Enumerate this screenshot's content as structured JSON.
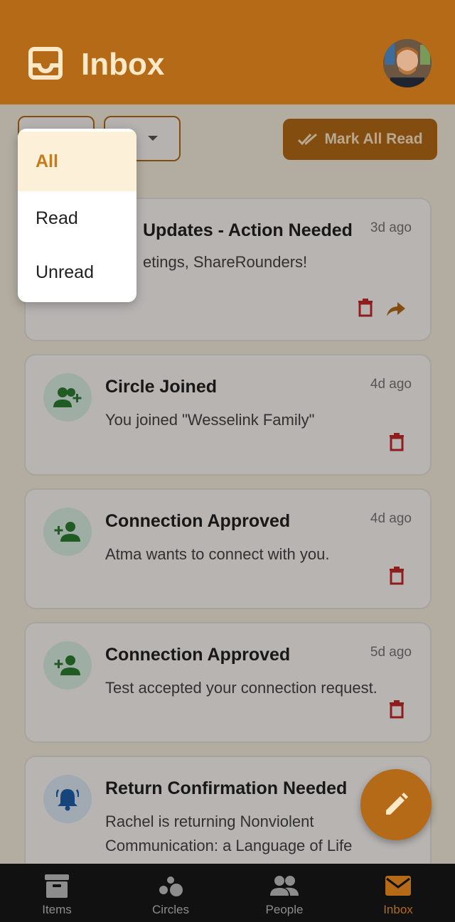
{
  "header": {
    "title": "Inbox",
    "icon": "inbox-tray-icon",
    "avatar": "user-avatar"
  },
  "toolbar": {
    "mark_all_read": "Mark All Read"
  },
  "filter_menu": {
    "options": [
      {
        "label": "All",
        "selected": true
      },
      {
        "label": "Read",
        "selected": false
      },
      {
        "label": "Unread",
        "selected": false
      }
    ]
  },
  "notifications": [
    {
      "title": "Updates - Action Needed",
      "body": "etings, ShareRounders!",
      "time": "3d ago",
      "icon": "megaphone-icon"
    },
    {
      "title": "Circle Joined",
      "body": "You joined \"Wesselink Family\"",
      "time": "4d ago",
      "icon": "group-add-icon"
    },
    {
      "title": "Connection Approved",
      "body": "Atma wants to connect with you.",
      "time": "4d ago",
      "icon": "person-add-icon"
    },
    {
      "title": "Connection Approved",
      "body": "Test accepted your connection request.",
      "time": "5d ago",
      "icon": "person-add-icon"
    },
    {
      "title": "Return Confirmation Needed",
      "body": "Rachel is returning Nonviolent Communication: a Language of Life",
      "time": "",
      "icon": "bell-icon"
    }
  ],
  "nav": {
    "items": [
      {
        "label": "Items",
        "icon": "archive-box-icon",
        "active": false
      },
      {
        "label": "Circles",
        "icon": "bubbles-icon",
        "active": false
      },
      {
        "label": "People",
        "icon": "people-icon",
        "active": false
      },
      {
        "label": "Inbox",
        "icon": "envelope-icon",
        "active": true
      }
    ]
  },
  "colors": {
    "brand": "#b46a17",
    "danger": "#c62828",
    "success": "#2e7d32",
    "info": "#1e5fa8"
  }
}
